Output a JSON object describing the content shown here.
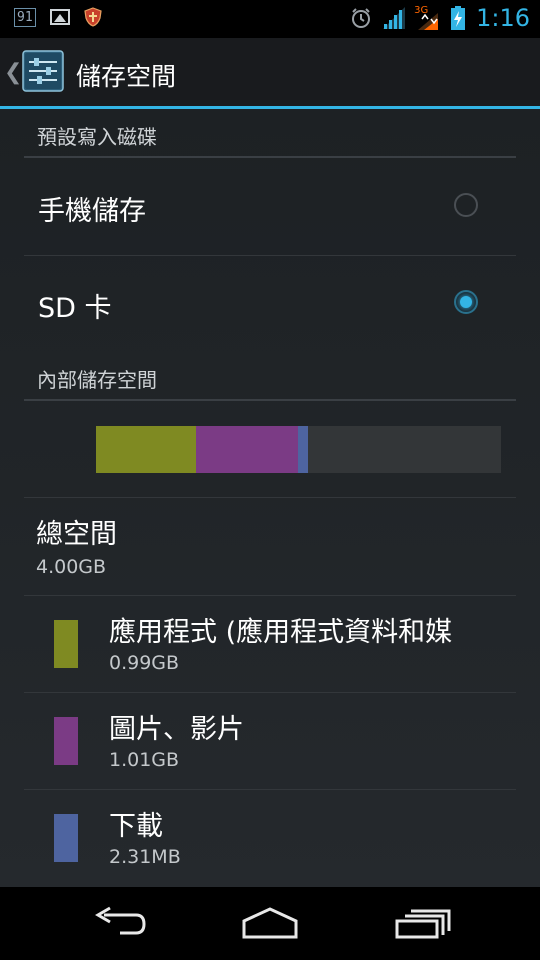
{
  "status_bar": {
    "notification_badge": "91",
    "icons": [
      "notification-91-icon",
      "image-icon",
      "shield-icon",
      "alarm-icon",
      "signal-icon",
      "3g-icon",
      "battery-charging-icon"
    ],
    "network_type": "3G",
    "time": "1:16"
  },
  "action_bar": {
    "title": "儲存空間",
    "app_icon": "settings-sliders-icon",
    "up_icon": "chevron-left-icon"
  },
  "sections": {
    "default_disk_header": "預設寫入磁碟",
    "internal_storage_header": "內部儲存空間"
  },
  "options": [
    {
      "label": "手機儲存",
      "selected": false
    },
    {
      "label": "SD 卡",
      "selected": true
    }
  ],
  "storage_bar": {
    "segments": [
      {
        "name": "應用程式",
        "fraction": 0.2475,
        "color": "#7f8a22"
      },
      {
        "name": "圖片、影片",
        "fraction": 0.2525,
        "color": "#7b3b85"
      },
      {
        "name": "下載",
        "fraction": 0.0225,
        "color": "#4e64a0"
      }
    ],
    "remainder_color": "#333638"
  },
  "total": {
    "label": "總空間",
    "value": "4.00GB"
  },
  "categories": [
    {
      "title": "應用程式 (應用程式資料和媒",
      "value": "0.99GB",
      "color": "#7f8a22"
    },
    {
      "title": "圖片、影片",
      "value": "1.01GB",
      "color": "#7b3b85"
    },
    {
      "title": "下載",
      "value": "2.31MB",
      "color": "#4e64a0"
    }
  ],
  "nav_bar": {
    "icons": [
      "back-icon",
      "home-icon",
      "recent-apps-icon"
    ]
  },
  "colors": {
    "accent": "#33b5e5"
  }
}
